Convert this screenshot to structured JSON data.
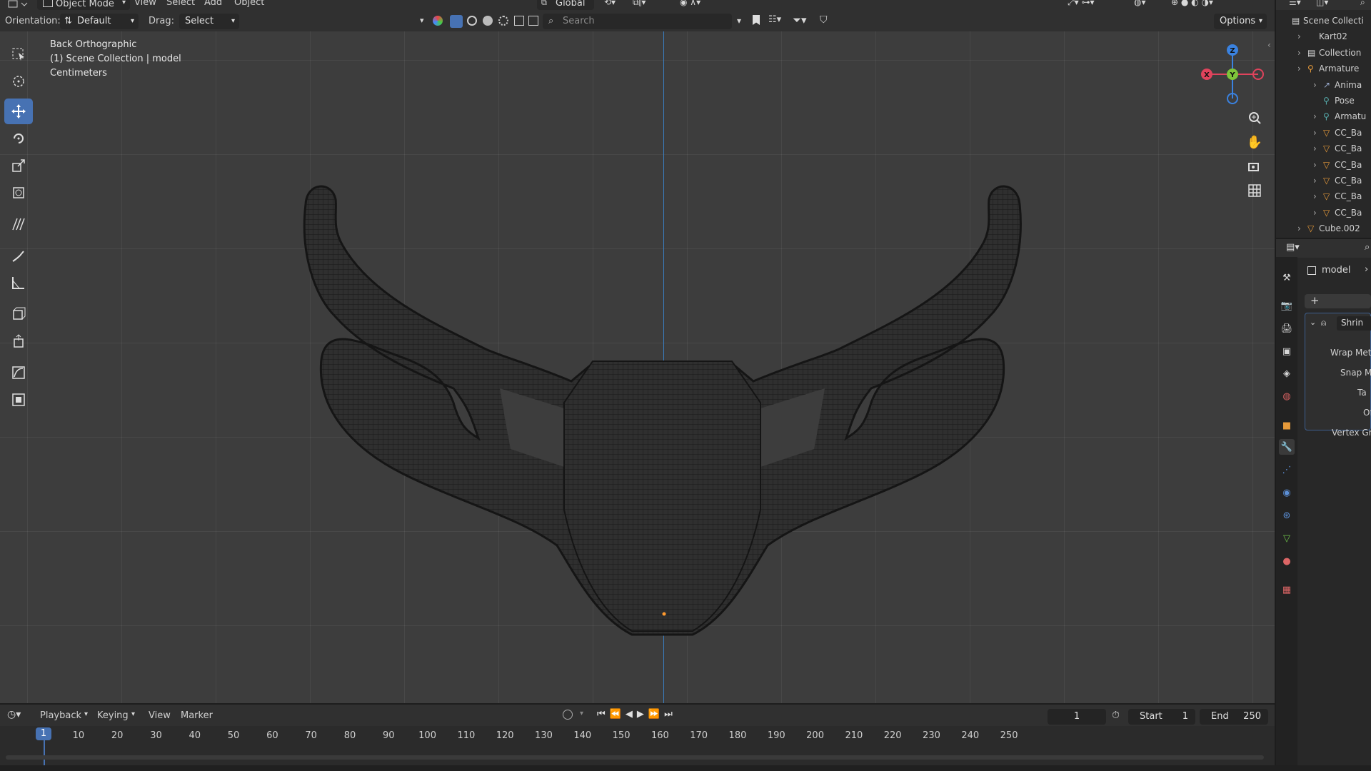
{
  "header": {
    "mode": "Object Mode",
    "menus": [
      "View",
      "Select",
      "Add",
      "Object"
    ],
    "orientation_label": "Orientation:",
    "orientation_value": "Default",
    "drag_label": "Drag:",
    "drag_value": "Select Box",
    "transform_space": "Global",
    "search_placeholder": "Search",
    "options_label": "Options"
  },
  "viewport": {
    "view_name": "Back Orthographic",
    "collection_info": "(1) Scene Collection | model",
    "units": "Centimeters",
    "gizmo": {
      "x": "X",
      "y": "Y",
      "z": "Z"
    }
  },
  "toolbar": {
    "tools": [
      "select-box",
      "cursor",
      "move",
      "rotate",
      "scale",
      "transform",
      "grease",
      "annotate",
      "measure",
      "add-cube",
      "extrude",
      "shrink",
      "edge"
    ],
    "active": "move"
  },
  "outliner": {
    "items": [
      {
        "label": "Scene Collecti",
        "indent": 0,
        "icon": "collection"
      },
      {
        "label": "Kart02",
        "indent": 1,
        "icon": "none"
      },
      {
        "label": "Collection",
        "indent": 1,
        "icon": "collection"
      },
      {
        "label": "Armature",
        "indent": 1,
        "icon": "armature"
      },
      {
        "label": "Anima",
        "indent": 2,
        "icon": "anim"
      },
      {
        "label": "Pose",
        "indent": 2,
        "icon": "pose"
      },
      {
        "label": "Armatu",
        "indent": 2,
        "icon": "armdata"
      },
      {
        "label": "CC_Ba",
        "indent": 2,
        "icon": "mesh"
      },
      {
        "label": "CC_Ba",
        "indent": 2,
        "icon": "mesh"
      },
      {
        "label": "CC_Ba",
        "indent": 2,
        "icon": "mesh"
      },
      {
        "label": "CC_Ba",
        "indent": 2,
        "icon": "mesh"
      },
      {
        "label": "CC_Ba",
        "indent": 2,
        "icon": "mesh"
      },
      {
        "label": "CC_Ba",
        "indent": 2,
        "icon": "mesh"
      },
      {
        "label": "Cube.002",
        "indent": 1,
        "icon": "mesh"
      }
    ]
  },
  "properties": {
    "object_name": "model",
    "add_modifier": "+",
    "modifier_name": "Shrin",
    "fields": [
      "Wrap Met",
      "Snap M",
      "Ta",
      "Of",
      "Vertex Gr"
    ]
  },
  "timeline": {
    "menus": [
      "Playback",
      "Keying",
      "View",
      "Marker"
    ],
    "current_frame": "1",
    "start_label": "Start",
    "start_value": "1",
    "end_label": "End",
    "end_value": "250",
    "frame_marker": "1",
    "ticks": [
      "10",
      "20",
      "30",
      "40",
      "50",
      "60",
      "70",
      "80",
      "90",
      "100",
      "110",
      "120",
      "130",
      "140",
      "150",
      "160",
      "170",
      "180",
      "190",
      "200",
      "210",
      "220",
      "230",
      "240",
      "250"
    ]
  },
  "colors": {
    "accent": "#4772b3",
    "axis_x": "#e0435c",
    "axis_y": "#7ec53a",
    "axis_z": "#3a82e0",
    "viewport_bg": "#3d3d3d"
  }
}
